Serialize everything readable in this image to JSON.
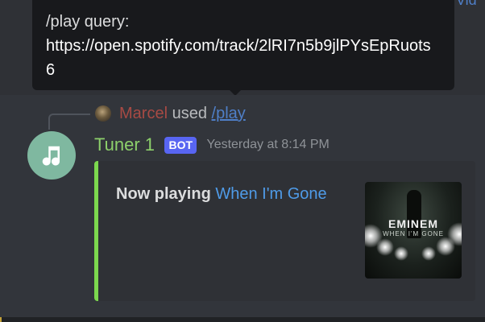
{
  "background_peek": {
    "text": "r Vid"
  },
  "tooltip": {
    "label": "/play query:",
    "value": "https://open.spotify.com/track/2lRI7n5b9jlPYsEpRuots6"
  },
  "reply": {
    "username": "Marcel",
    "used_text": "used",
    "command": "/play"
  },
  "message": {
    "bot_name": "Tuner 1",
    "bot_tag": "BOT",
    "timestamp": "Yesterday at 8:14 PM",
    "avatar_icon": "music-note-icon"
  },
  "embed": {
    "prefix": "Now playing",
    "song_title": "When I'm Gone",
    "accent_color": "#7cd84e",
    "thumbnail": {
      "artist_text": "EMINEM",
      "album_text": "WHEN I'M GONE"
    }
  },
  "colors": {
    "username_color": "#a84a44",
    "bot_name_color": "#8dd06b",
    "link_color": "#4f9be8",
    "bot_tag_color": "#5865f2"
  }
}
